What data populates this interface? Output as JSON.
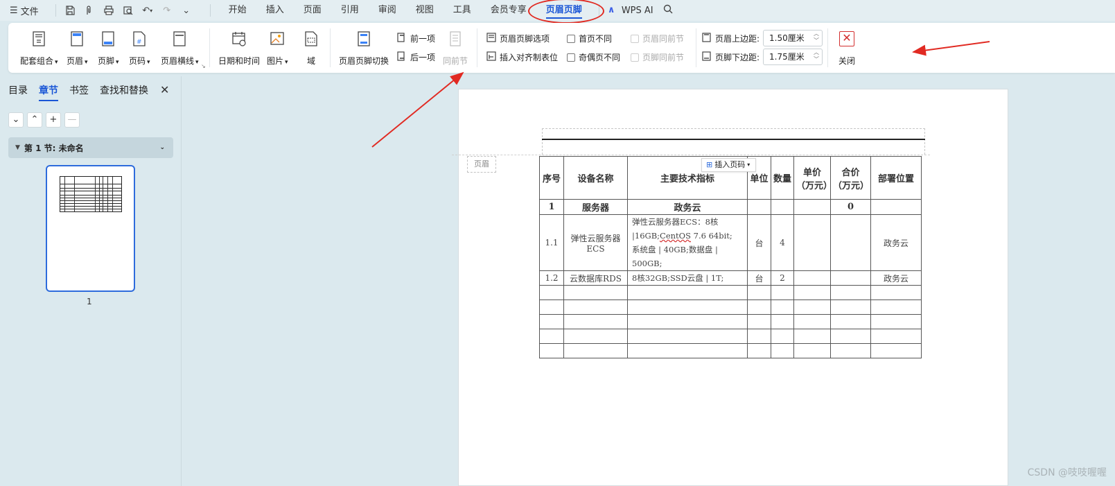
{
  "menubar": {
    "file_label": "文件",
    "tabs": [
      "开始",
      "插入",
      "页面",
      "引用",
      "审阅",
      "视图",
      "工具",
      "会员专享",
      "页眉页脚"
    ],
    "active_tab": "页眉页脚",
    "wps_ai": "WPS AI"
  },
  "ribbon": {
    "buttons": {
      "combo": "配套组合",
      "header": "页眉",
      "footer": "页脚",
      "page_number": "页码",
      "header_line": "页眉横线",
      "datetime": "日期和时间",
      "image": "图片",
      "field": "域",
      "switch": "页眉页脚切换",
      "prev": "前一项",
      "next": "后一项",
      "same_as_prev": "同前节",
      "options": "页眉页脚选项",
      "align_tab": "插入对齐制表位",
      "first_diff": "首页不同",
      "odd_even_diff": "奇偶页不同",
      "header_same_prev": "页眉同前节",
      "footer_same_prev": "页脚同前节",
      "header_margin_label": "页眉上边距:",
      "header_margin_value": "1.50厘米",
      "footer_margin_label": "页脚下边距:",
      "footer_margin_value": "1.75厘米",
      "close": "关闭"
    }
  },
  "left_panel": {
    "tabs": [
      "目录",
      "章节",
      "书签",
      "查找和替换"
    ],
    "active_tab": "章节",
    "section_title": "第 1 节: 未命名",
    "page_number": "1"
  },
  "document": {
    "header_tag": "页眉",
    "insert_page_number": "插入页码",
    "table": {
      "headers": [
        "序号",
        "设备名称",
        "主要技术指标",
        "单位",
        "数量",
        "单价（万元）",
        "合价（万元）",
        "部署位置"
      ],
      "rows": [
        [
          "1",
          "服务器",
          "政务云",
          "",
          "",
          "",
          "0",
          ""
        ],
        [
          "1.1",
          "弹性云服务器ECS",
          "弹性云服务器ECS：8核|16GB;CentOS 7.6 64bit;系统盘 | 40GB;数据盘 | 500GB;",
          "台",
          "4",
          "",
          "",
          "政务云"
        ],
        [
          "1.2",
          "云数据库RDS",
          "8核32GB;SSD云盘 | 1T;",
          "台",
          "2",
          "",
          "",
          "政务云"
        ]
      ],
      "spec_lines": [
        "弹性云服务器ECS：8核",
        "|16GB;",
        "CentOS",
        " 7.6 64bit;",
        "系统盘 | 40GB;数据盘 |",
        "500GB;"
      ],
      "empty_rows": 5
    }
  },
  "watermark": "CSDN @吱吱喔喔",
  "colors": {
    "accent": "#1a56d6",
    "annotation_red": "#e12a22",
    "background": "#dbe9ee"
  }
}
